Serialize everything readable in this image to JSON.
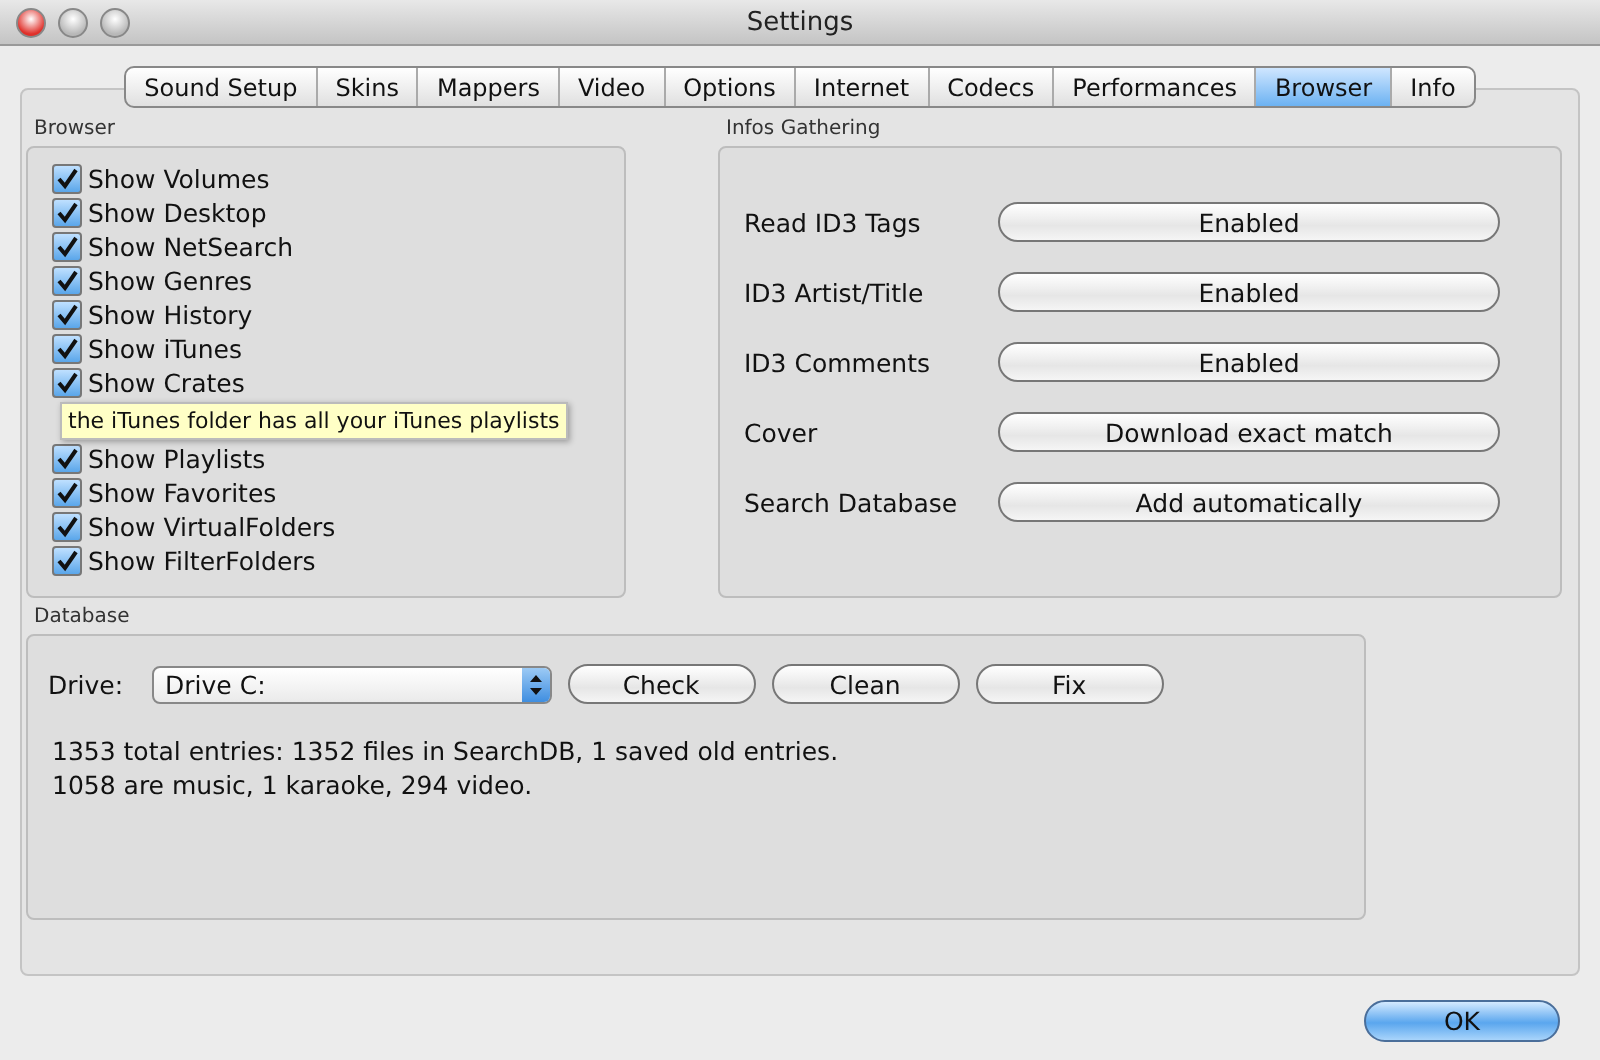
{
  "window": {
    "title": "Settings"
  },
  "tabs": [
    {
      "label": "Sound Setup",
      "selected": false
    },
    {
      "label": "Skins",
      "selected": false
    },
    {
      "label": "Mappers",
      "selected": false
    },
    {
      "label": "Video",
      "selected": false
    },
    {
      "label": "Options",
      "selected": false
    },
    {
      "label": "Internet",
      "selected": false
    },
    {
      "label": "Codecs",
      "selected": false
    },
    {
      "label": "Performances",
      "selected": false
    },
    {
      "label": "Browser",
      "selected": true
    },
    {
      "label": "Info",
      "selected": false
    }
  ],
  "browser": {
    "title": "Browser",
    "items": [
      {
        "label": "Show Volumes",
        "checked": true
      },
      {
        "label": "Show Desktop",
        "checked": true
      },
      {
        "label": "Show NetSearch",
        "checked": true
      },
      {
        "label": "Show Genres",
        "checked": true
      },
      {
        "label": "Show History",
        "checked": true
      },
      {
        "label": "Show iTunes",
        "checked": true
      },
      {
        "label": "Show Crates",
        "checked": true
      },
      {
        "label": "Show Playlists",
        "checked": true
      },
      {
        "label": "Show Favorites",
        "checked": true
      },
      {
        "label": "Show VirtualFolders",
        "checked": true
      },
      {
        "label": "Show FilterFolders",
        "checked": true
      }
    ],
    "tooltip": "the iTunes folder has all your iTunes playlists"
  },
  "infos": {
    "title": "Infos Gathering",
    "rows": [
      {
        "label": "Read ID3 Tags",
        "value": "Enabled"
      },
      {
        "label": "ID3 Artist/Title",
        "value": "Enabled"
      },
      {
        "label": "ID3 Comments",
        "value": "Enabled"
      },
      {
        "label": "Cover",
        "value": "Download exact match"
      },
      {
        "label": "Search Database",
        "value": "Add automatically"
      }
    ]
  },
  "database": {
    "title": "Database",
    "drive_label": "Drive:",
    "drive": "Drive C:",
    "buttons": [
      "Check",
      "Clean",
      "Fix"
    ],
    "lines": [
      "1353 total entries: 1352 files in SearchDB, 1 saved old entries.",
      "1058 are music, 1 karaoke, 294 video."
    ]
  },
  "ok": "OK"
}
